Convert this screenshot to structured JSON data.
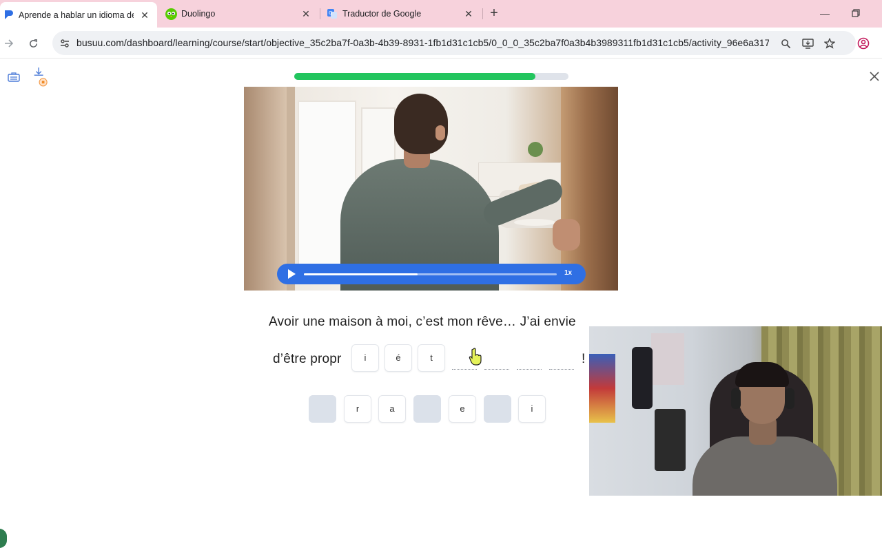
{
  "browser": {
    "tabs": [
      {
        "title": "Aprende a hablar un idioma de",
        "active": true
      },
      {
        "title": "Duolingo",
        "active": false
      },
      {
        "title": "Traductor de Google",
        "active": false
      }
    ],
    "address": "busuu.com/dashboard/learning/course/start/objective_35c2ba7f-0a3b-4b39-8931-1fb1d31c1cb5/0_0_0_35c2ba7f0a3b4b3989311fb1d31c1cb5/activity_96e6a317-..."
  },
  "lesson": {
    "progress_fraction": 0.88,
    "audio": {
      "speed_label": "1x",
      "played_fraction": 0.45
    },
    "sentence_line1": "Avoir une maison à moi, c’est mon rêve… J’ai envie",
    "sentence_line2_start": "d’être propr",
    "sentence_line2_end": "!",
    "placed_letters": [
      "i",
      "é",
      "t"
    ],
    "empty_slots": 4,
    "letter_bank": [
      "",
      "r",
      "a",
      "",
      "e",
      "",
      "i"
    ]
  },
  "colors": {
    "tabstrip": "#f7d2dc",
    "progress": "#22c55e",
    "player": "#2f6fe4"
  }
}
